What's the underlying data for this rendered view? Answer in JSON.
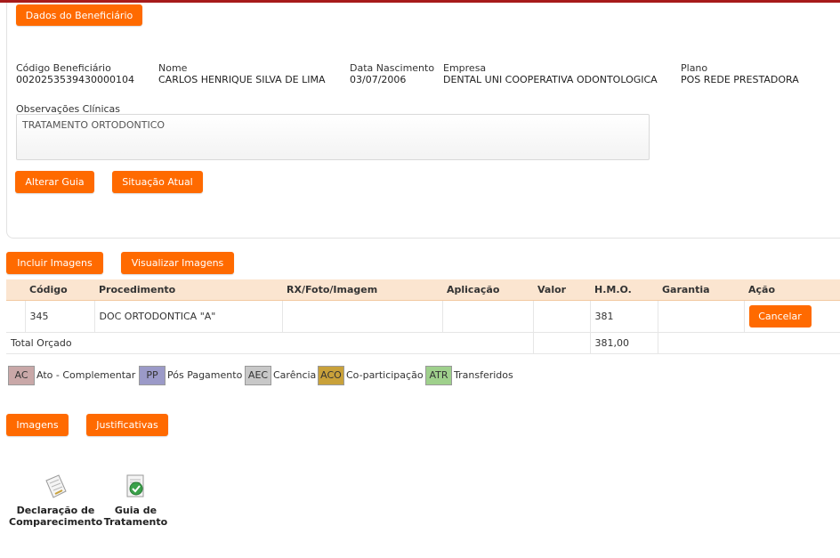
{
  "header_button": "Dados do Beneficiário",
  "beneficiary": {
    "codigo_label": "Código Beneficiário",
    "codigo": "0020253539430000104",
    "nome_label": "Nome",
    "nome": "CARLOS HENRIQUE SILVA DE LIMA",
    "nascimento_label": "Data Nascimento",
    "nascimento": "03/07/2006",
    "empresa_label": "Empresa",
    "empresa": "DENTAL UNI COOPERATIVA ODONTOLOGICA",
    "plano_label": "Plano",
    "plano": "POS REDE PRESTADORA"
  },
  "observacoes": {
    "label": "Observações Clínicas",
    "value": "TRATAMENTO ORTODONTICO"
  },
  "actions": {
    "alterar": "Alterar Guia",
    "situacao": "Situação Atual",
    "incluir": "Incluir Imagens",
    "visualizar": "Visualizar Imagens"
  },
  "table": {
    "headers": {
      "codigo": "Código",
      "procedimento": "Procedimento",
      "rx": "RX/Foto/Imagem",
      "aplicacao": "Aplicação",
      "valor": "Valor",
      "hmo": "H.M.O.",
      "garantia": "Garantia",
      "acao": "Ação"
    },
    "rows": [
      {
        "codigo": "345",
        "procedimento": "DOC ORTODONTICA \"A\"",
        "rx": "",
        "aplicacao": "",
        "valor": "",
        "hmo": "381",
        "garantia": "",
        "acao": "Cancelar"
      }
    ],
    "total_label": "Total Orçado",
    "total_hmo": "381,00"
  },
  "legend": [
    {
      "code": "AC",
      "label": "Ato - Complementar",
      "color": "#c9a8a8"
    },
    {
      "code": "PP",
      "label": "Pós Pagamento",
      "color": "#9b9ac8"
    },
    {
      "code": "AEC",
      "label": "Carência",
      "color": "#c8c8c8"
    },
    {
      "code": "ACO",
      "label": "Co-participação",
      "color": "#c9a13a"
    },
    {
      "code": "ATR",
      "label": "Transferidos",
      "color": "#9fd08c"
    }
  ],
  "bottom_buttons": {
    "imagens": "Imagens",
    "justificativas": "Justificativas"
  },
  "documents": {
    "declaracao_line1": "Declaração de",
    "declaracao_line2": "Comparecimento",
    "guia_line1": "Guia de",
    "guia_line2": "Tratamento"
  },
  "colors": {
    "accent": "#ff6a00",
    "topbar": "#a71b1b",
    "table_header": "#fbe5d0"
  }
}
